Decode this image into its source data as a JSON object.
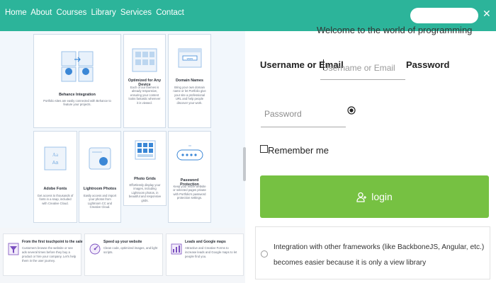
{
  "nav": {
    "links": [
      "Home",
      "About",
      "Courses",
      "Library",
      "Services",
      "Contact"
    ],
    "search_placeholder": "",
    "close_glyph": "✕"
  },
  "colors": {
    "navbar": "#2cb49a",
    "login_button": "#76c142",
    "card_border": "#cfdbe8",
    "icon_blue": "#3b87d6",
    "icon_purple": "#7a4fbf"
  },
  "left": {
    "cards": [
      {
        "title": "Behance Integration",
        "desc": "Portfolio sites are easily connected with Behance to feature your projects.",
        "icon": "behance-sync-icon"
      },
      {
        "title": "Optimized for Any Device",
        "desc": "Each of our themes is already responsive, ensuring your content looks fantastic wherever it is viewed.",
        "icon": "devices-icon"
      },
      {
        "title": "Domain Names",
        "desc": "Bring your own domain name or let Portfolio give your site a professional URL and help people discover your work.",
        "icon": "domain-icon"
      },
      {
        "title": "Adobe Fonts",
        "desc": "Get access to thousands of fonts in a snap, included with Creative Cloud.",
        "icon": "fonts-icon"
      },
      {
        "title": "Lightroom Photos",
        "desc": "Easily access and import your photos from Lightroom CC and Creative Cloud.",
        "icon": "lightroom-icon"
      },
      {
        "title": "Photo Grids",
        "desc": "Effortlessly display your images, including Lightroom photos, in beautiful and responsive grids.",
        "icon": "photo-grid-icon"
      },
      {
        "title": "Password Protection",
        "desc": "Keep your entire website or selected pages private with Portfolio's password protection settings.",
        "icon": "password-icon"
      }
    ],
    "features": [
      {
        "title": "From the first touchpoint to the sale",
        "desc": "Customers browse the website or see ads several times before they buy a product or hire your company. Let's help them in the user journey.",
        "icon": "funnel-icon"
      },
      {
        "title": "Speed up your website",
        "desc": "Clean code, optimized images, and light scripts.",
        "icon": "speed-icon"
      },
      {
        "title": "Leads and Google maps",
        "desc": "Attractive and Creative Forms to increase leads and Google maps to let people find you.",
        "icon": "leads-icon"
      }
    ]
  },
  "login": {
    "welcome": "Welcome to the world of programming",
    "username_label": "Username or Email",
    "username_placeholder": "Username or Email",
    "password_label": "Password",
    "password_placeholder": "Password",
    "remember_label": "Remember me",
    "button_label": "login",
    "option_text": "Integration with other frameworks (like BackboneJS, Angular, etc.) becomes easier because it is only a view library"
  }
}
